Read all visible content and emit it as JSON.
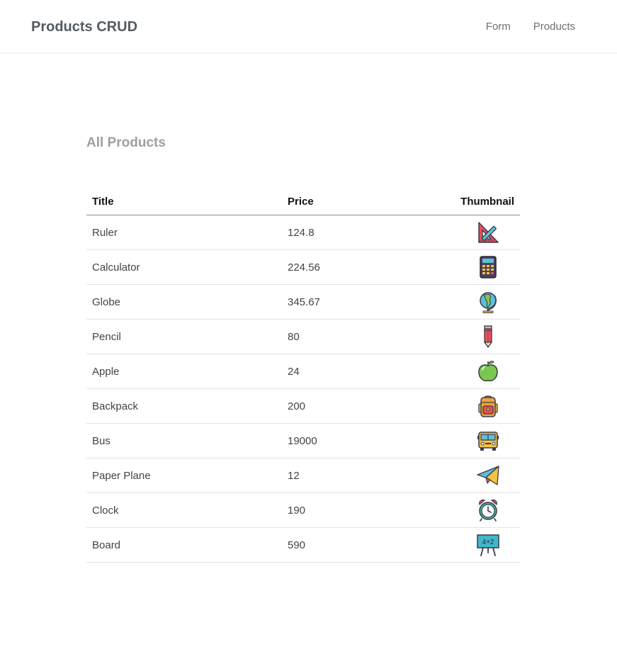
{
  "navbar": {
    "brand": "Products CRUD",
    "links": [
      {
        "label": "Form"
      },
      {
        "label": "Products"
      }
    ]
  },
  "main": {
    "heading": "All Products",
    "table": {
      "columns": [
        "Title",
        "Price",
        "Thumbnail"
      ],
      "rows": [
        {
          "title": "Ruler",
          "price": "124.8",
          "icon": "ruler-triangle-icon"
        },
        {
          "title": "Calculator",
          "price": "224.56",
          "icon": "calculator-icon"
        },
        {
          "title": "Globe",
          "price": "345.67",
          "icon": "globe-icon"
        },
        {
          "title": "Pencil",
          "price": "80",
          "icon": "pencil-icon"
        },
        {
          "title": "Apple",
          "price": "24",
          "icon": "apple-icon"
        },
        {
          "title": "Backpack",
          "price": "200",
          "icon": "backpack-icon"
        },
        {
          "title": "Bus",
          "price": "19000",
          "icon": "school-bus-icon"
        },
        {
          "title": "Paper Plane",
          "price": "12",
          "icon": "paper-plane-icon"
        },
        {
          "title": "Clock",
          "price": "190",
          "icon": "alarm-clock-icon"
        },
        {
          "title": "Board",
          "price": "590",
          "icon": "chalkboard-icon",
          "board_text": "4+2"
        }
      ]
    }
  }
}
